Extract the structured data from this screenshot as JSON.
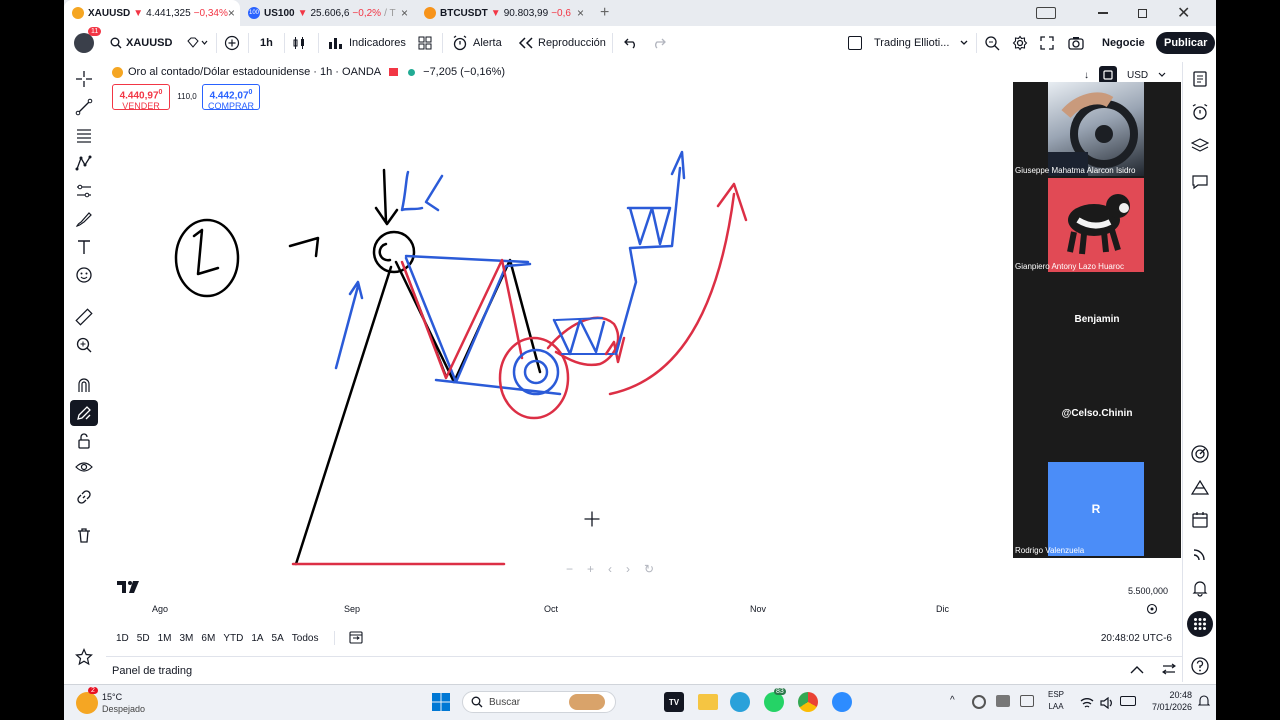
{
  "tabs": [
    {
      "symbol": "XAUUSD",
      "arrow": "▼",
      "price": "4.441,325",
      "change": "−0,34%",
      "icon_color": "#f5a623",
      "close": "×"
    },
    {
      "symbol": "US100",
      "arrow": "▼",
      "price": "25.606,6",
      "change": "−0,2%",
      "extra": "/ T",
      "icon_color": "#2962ff",
      "icon_text": "100",
      "close": "×"
    },
    {
      "symbol": "BTCUSDT",
      "arrow": "▼",
      "price": "90.803,99",
      "change": "−0,6",
      "icon_color": "#f7931a",
      "close": "×"
    }
  ],
  "new_tab": "+",
  "toolbar": {
    "avatar_badge": "11",
    "symbol": "XAUUSD",
    "timeframe": "1h",
    "indicators": "Indicadores",
    "alert": "Alerta",
    "replay": "Reproducción",
    "layout_name": "Trading Ellioti...",
    "trade": "Negocie",
    "publish": "Publicar"
  },
  "legend": {
    "title": "Oro al contado/Dólar estadounidense · 1h · OANDA",
    "change": "−7,205 (−0,16%)"
  },
  "price_boxes": {
    "sell_price": "4.440,97",
    "sell_sup": "0",
    "sell_label": "VENDER",
    "spread": "110,0",
    "buy_price": "4.442,07",
    "buy_sup": "0",
    "buy_label": "COMPRAR"
  },
  "currency": "USD",
  "price_scale_label": "5.500,000",
  "participants": [
    {
      "name": "Giuseppe Mahatma Alarcon Isidro"
    },
    {
      "name": "Gianpiero Antony Lazo Huaroc"
    },
    {
      "name": "Benjamin"
    },
    {
      "name": "@Celso.Chinin"
    },
    {
      "name": "Rodrigo Valenzuela",
      "initial": "R"
    }
  ],
  "time_axis": [
    "Ago",
    "Sep",
    "Oct",
    "Nov",
    "Dic"
  ],
  "ranges": [
    "1D",
    "5D",
    "1M",
    "3M",
    "6M",
    "YTD",
    "1A",
    "5A",
    "Todos"
  ],
  "clock": "20:48:02 UTC-6",
  "panel_label": "Panel de trading",
  "drawing_label": "1",
  "taskbar": {
    "weather_badge": "2",
    "temp": "15°C",
    "weather": "Despejado",
    "search": "Buscar",
    "whatsapp_badge": "83",
    "lang1": "ESP",
    "lang2": "LAA",
    "time": "20:48",
    "date": "7/01/2026"
  },
  "colors": {
    "red": "#f23645",
    "blue": "#2962ff",
    "drawing_blue": "#2b5bd8",
    "drawing_red": "#dc2f45"
  }
}
